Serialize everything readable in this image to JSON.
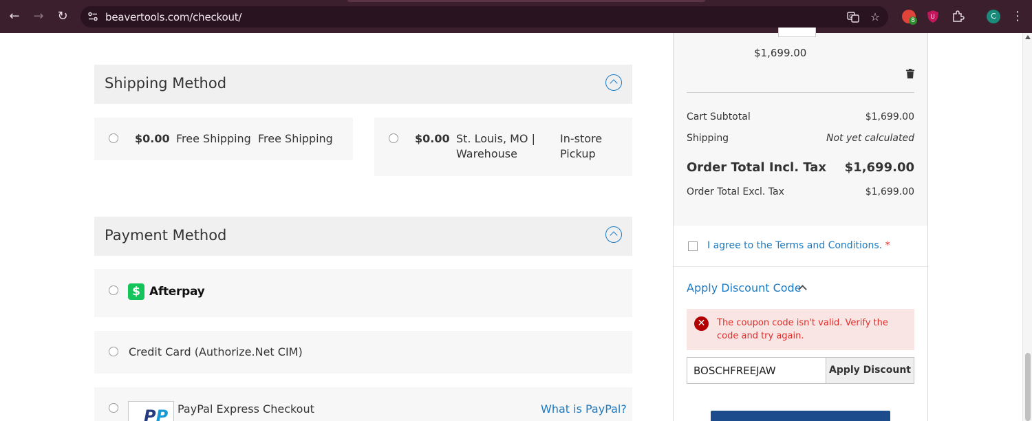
{
  "browser": {
    "url": "beavertools.com/checkout/",
    "extension_badge": "8",
    "profile_initial": "C"
  },
  "shipping": {
    "title": "Shipping Method",
    "options": [
      {
        "price": "$0.00",
        "carrier": "Free Shipping",
        "method": "Free Shipping"
      },
      {
        "price": "$0.00",
        "carrier_line1": "St. Louis, MO |",
        "carrier_line2": "Warehouse",
        "method_line1": "In-store",
        "method_line2": "Pickup"
      }
    ]
  },
  "payment": {
    "title": "Payment Method",
    "methods": [
      {
        "name": "Afterpay",
        "logo_glyph": "$"
      },
      {
        "name": "Credit Card (Authorize.Net CIM)"
      },
      {
        "name": "PayPal Express Checkout",
        "link": "What is PayPal?"
      }
    ]
  },
  "summary": {
    "item_price": "$1,699.00",
    "rows": {
      "subtotal": {
        "label": "Cart Subtotal",
        "value": "$1,699.00"
      },
      "shipping": {
        "label": "Shipping",
        "value": "Not yet calculated"
      },
      "total_incl": {
        "label": "Order Total Incl. Tax",
        "value": "$1,699.00"
      },
      "total_excl": {
        "label": "Order Total Excl. Tax",
        "value": "$1,699.00"
      }
    },
    "terms_label": "I agree to the Terms and Conditions.",
    "terms_required_mark": "*"
  },
  "discount": {
    "toggle_label": "Apply Discount Code",
    "error_message": "The coupon code isn't valid. Verify the code and try again.",
    "error_glyph": "✕",
    "code_value": "BOSCHFREEJAW",
    "apply_label": "Apply Discount"
  },
  "colors": {
    "link": "#1979c3",
    "error_text": "#e02b27",
    "error_bg": "#fae5e5",
    "section_bg": "#f0f0f0",
    "browser_frame": "#3c1f2c"
  }
}
